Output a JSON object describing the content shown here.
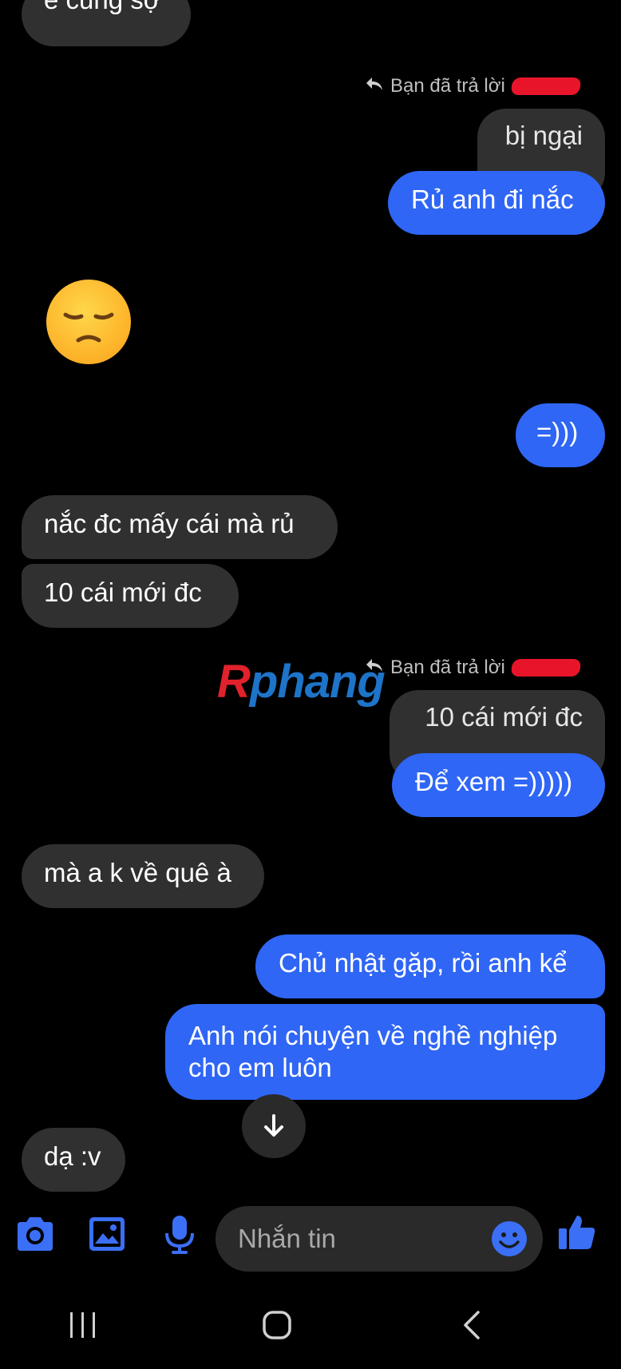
{
  "messages": {
    "top_partial": "e cũng sợ",
    "reply_note_1": "Bạn đã trả lời",
    "quoted_1": "bị ngại",
    "sent_1": "Rủ anh đi nắc",
    "sent_2": "=)))",
    "recv_1": "nắc đc mấy cái mà rủ",
    "recv_2": "10 cái mới đc",
    "reply_note_2": "Bạn đã trả lời",
    "quoted_2": "10 cái mới đc",
    "sent_3": "Để xem =)))))",
    "recv_3": "mà a k về quê à",
    "sent_4": "Chủ nhật gặp, rồi anh kể",
    "sent_5_line1": "Anh nói chuyện về nghề nghiệp",
    "sent_5_line2": "cho em luôn",
    "recv_4": "dạ :v"
  },
  "watermark": {
    "first_letter": "R",
    "rest": "phang"
  },
  "composer": {
    "placeholder": "Nhắn tin"
  },
  "icons": {
    "camera": "camera-icon",
    "gallery": "gallery-icon",
    "mic": "microphone-icon",
    "emoji": "emoji-icon",
    "like": "thumbs-up-icon",
    "scroll": "arrow-down-icon",
    "reply": "reply-arrow-icon"
  },
  "colors": {
    "background": "#000000",
    "sent_bubble": "#2f66f5",
    "received_bubble": "#303030",
    "accent_icon": "#3b6ff5"
  }
}
